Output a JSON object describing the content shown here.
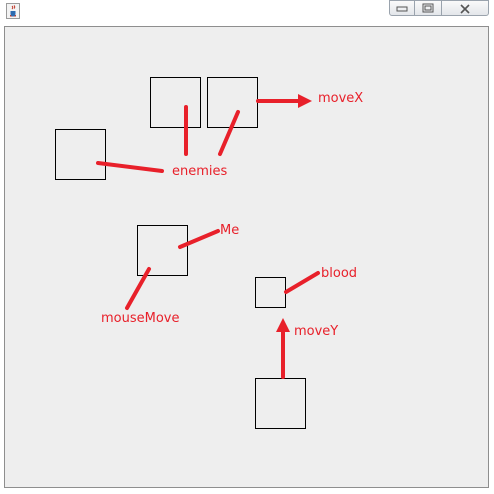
{
  "window": {
    "app_icon": "java-cup-icon",
    "controls": [
      "minimize-icon",
      "maximize-icon",
      "close-icon"
    ]
  },
  "annotations": {
    "enemies": "enemies",
    "moveX": "moveX",
    "me": "Me",
    "mouseMove": "mouseMove",
    "blood": "blood",
    "moveY": "moveY"
  },
  "colors": {
    "annotation": "#e8202a",
    "canvas_background": "#eeeeee",
    "box_border": "#000000"
  }
}
